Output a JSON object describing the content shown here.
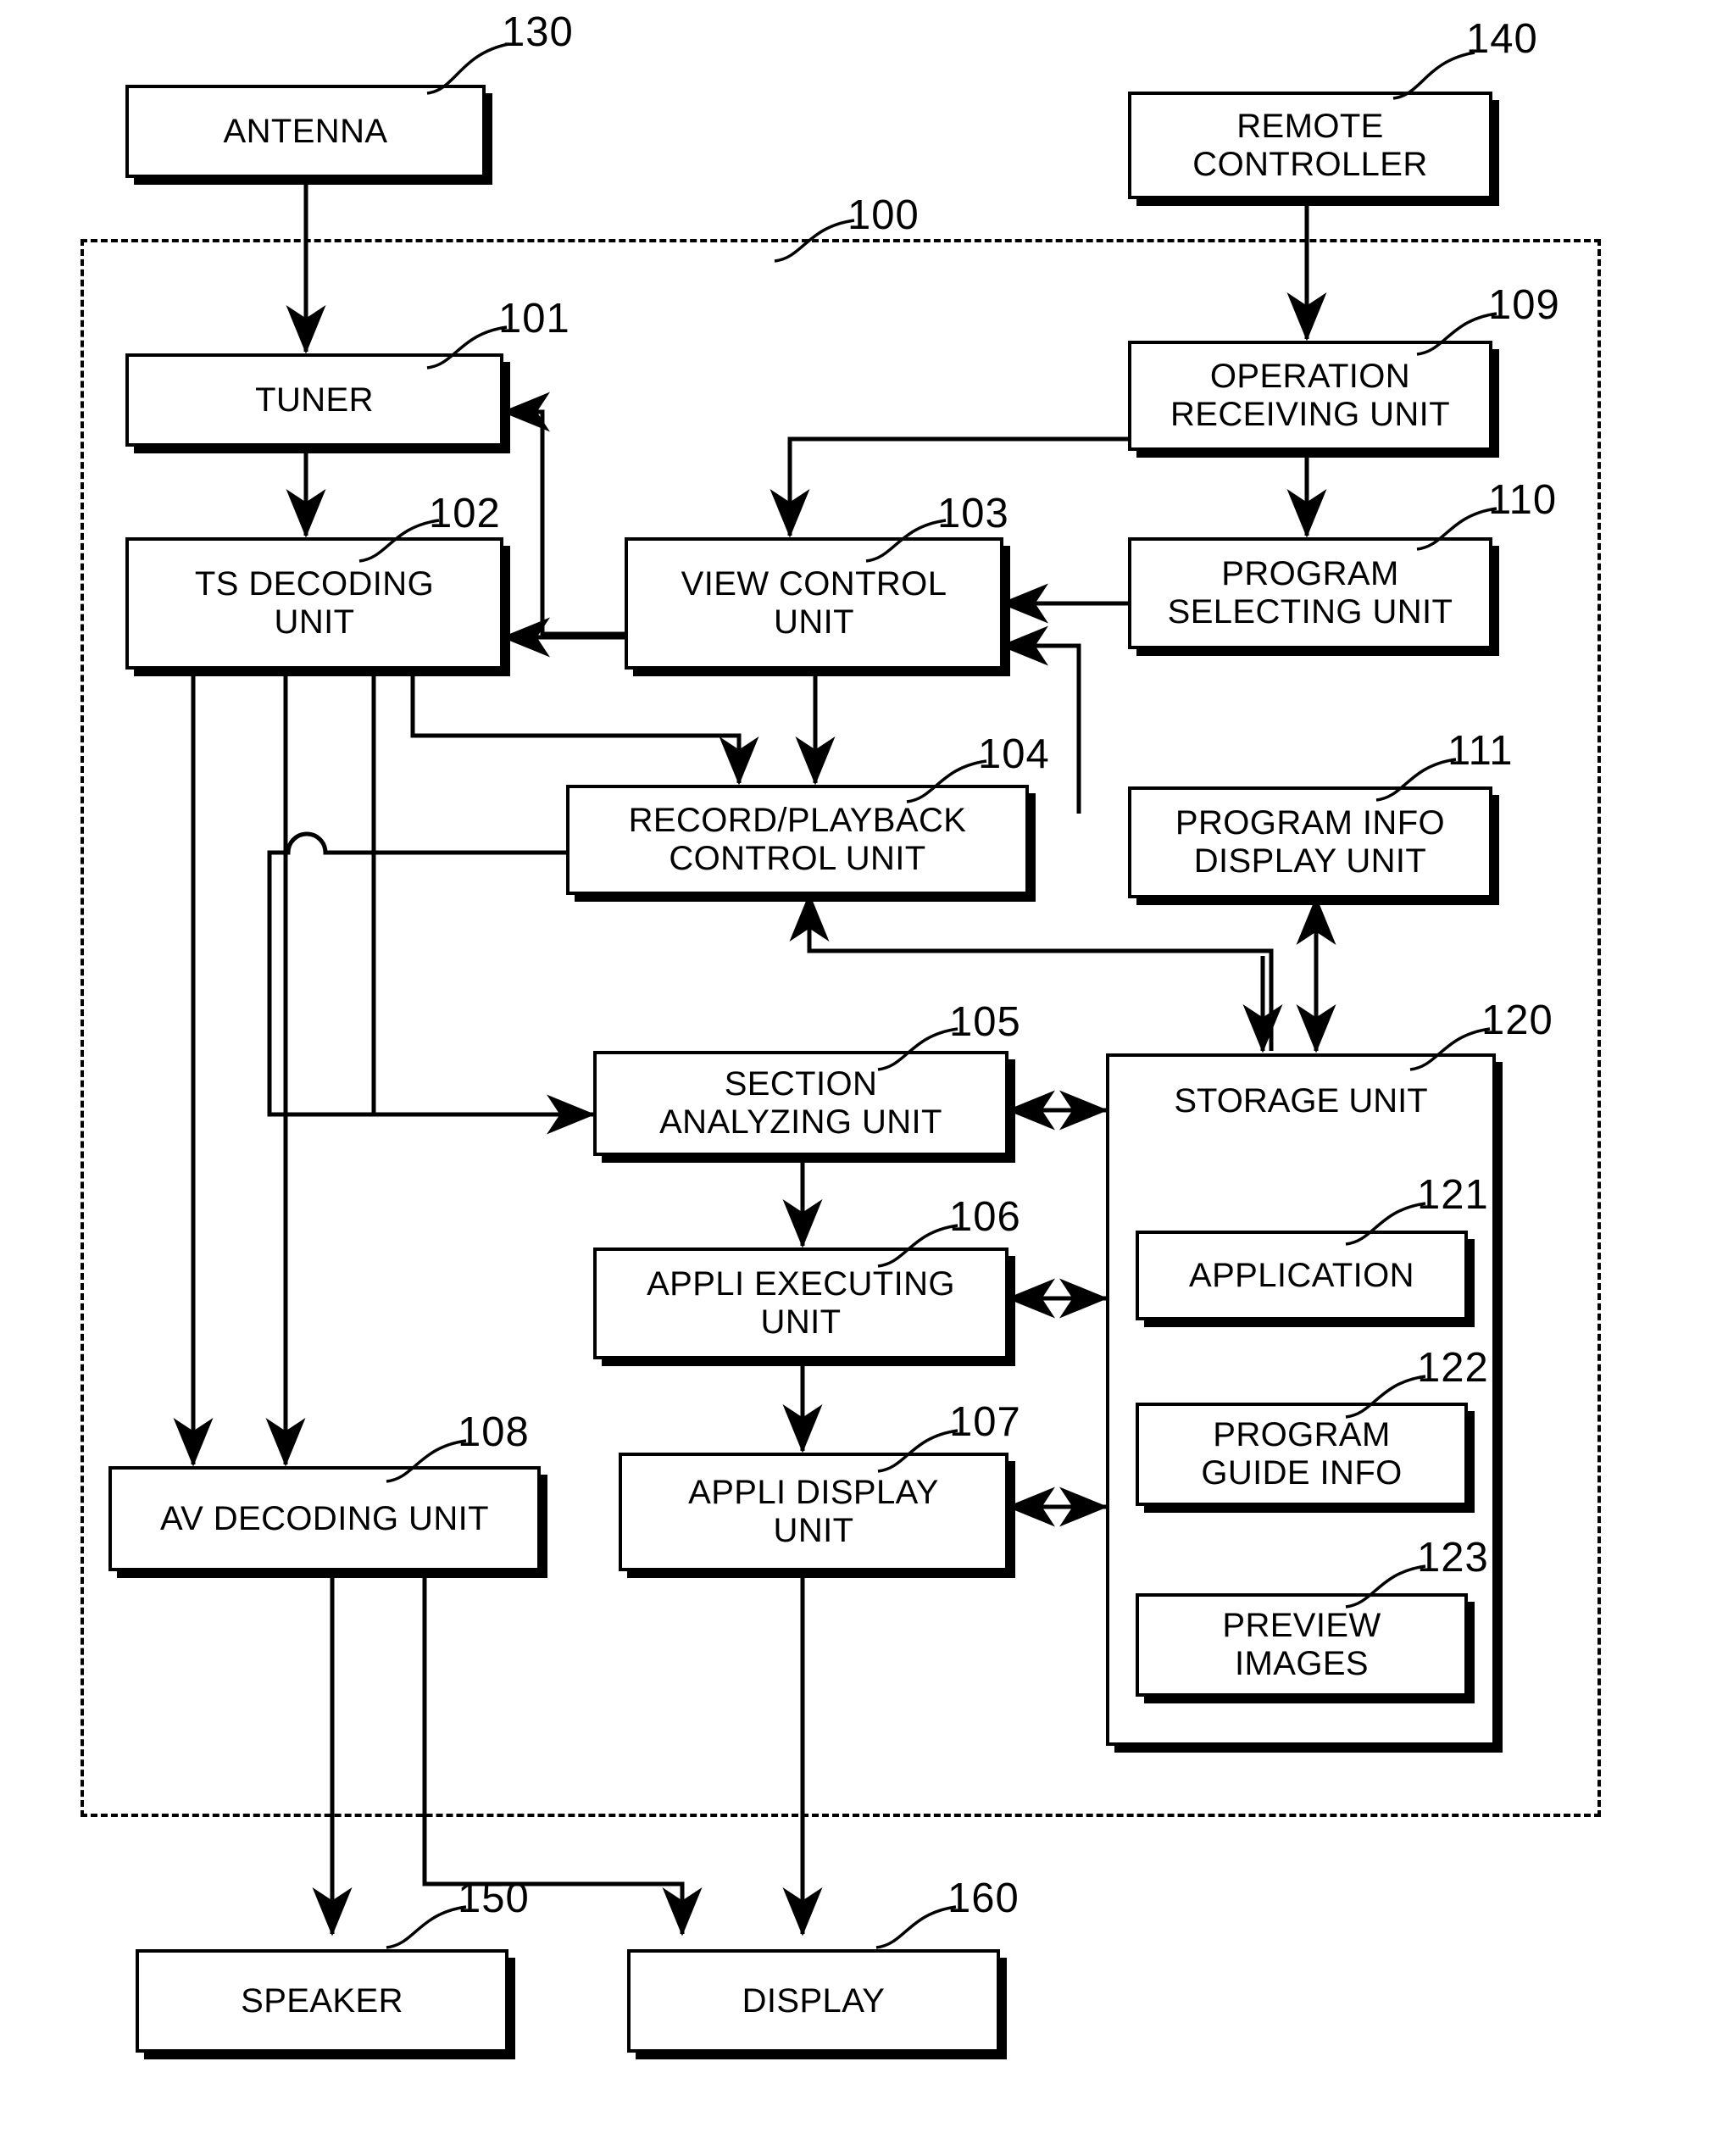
{
  "figure": {
    "type": "patent-block-diagram",
    "system_boundary_ref": "100"
  },
  "blocks": [
    {
      "id": "antenna",
      "label": "ANTENNA",
      "ref": "130"
    },
    {
      "id": "remote",
      "label": "REMOTE\nCONTROLLER",
      "ref": "140"
    },
    {
      "id": "tuner",
      "label": "TUNER",
      "ref": "101"
    },
    {
      "id": "tsdec",
      "label": "TS DECODING\nUNIT",
      "ref": "102"
    },
    {
      "id": "viewctl",
      "label": "VIEW CONTROL\nUNIT",
      "ref": "103"
    },
    {
      "id": "recplay",
      "label": "RECORD/PLAYBACK\nCONTROL UNIT",
      "ref": "104"
    },
    {
      "id": "section",
      "label": "SECTION\nANALYZING UNIT",
      "ref": "105"
    },
    {
      "id": "appliexec",
      "label": "APPLI EXECUTING\nUNIT",
      "ref": "106"
    },
    {
      "id": "applidisp",
      "label": "APPLI DISPLAY\nUNIT",
      "ref": "107"
    },
    {
      "id": "avdec",
      "label": "AV DECODING UNIT",
      "ref": "108"
    },
    {
      "id": "oprecv",
      "label": "OPERATION\nRECEIVING UNIT",
      "ref": "109"
    },
    {
      "id": "progsel",
      "label": "PROGRAM\nSELECTING UNIT",
      "ref": "110"
    },
    {
      "id": "proginfo",
      "label": "PROGRAM INFO\nDISPLAY UNIT",
      "ref": "111"
    },
    {
      "id": "storage",
      "label": "STORAGE UNIT",
      "ref": "120"
    },
    {
      "id": "applicat",
      "label": "APPLICATION",
      "ref": "121"
    },
    {
      "id": "guide",
      "label": "PROGRAM\nGUIDE INFO",
      "ref": "122"
    },
    {
      "id": "preview",
      "label": "PREVIEW\nIMAGES",
      "ref": "123"
    },
    {
      "id": "speaker",
      "label": "SPEAKER",
      "ref": "150"
    },
    {
      "id": "display",
      "label": "DISPLAY",
      "ref": "160"
    }
  ]
}
